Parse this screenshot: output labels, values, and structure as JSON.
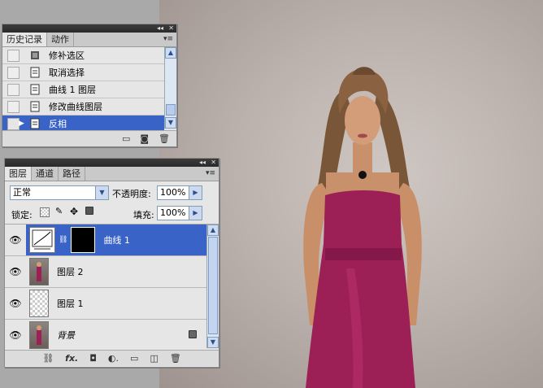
{
  "history_panel": {
    "tabs": [
      "历史记录",
      "动作"
    ],
    "items": [
      {
        "label": "修补选区",
        "icon": "patch-icon",
        "selected": false
      },
      {
        "label": "取消选择",
        "icon": "document-icon",
        "selected": false
      },
      {
        "label": "曲线 1 图层",
        "icon": "document-icon",
        "selected": false
      },
      {
        "label": "修改曲线图层",
        "icon": "document-icon",
        "selected": false
      },
      {
        "label": "反相",
        "icon": "document-icon",
        "selected": true
      }
    ]
  },
  "layers_panel": {
    "tabs": [
      "图层",
      "通道",
      "路径"
    ],
    "blend_mode": "正常",
    "opacity_label": "不透明度:",
    "opacity_value": "100%",
    "lock_label": "锁定:",
    "fill_label": "填充:",
    "fill_value": "100%",
    "layers": [
      {
        "label": "曲线 1",
        "selected": true
      },
      {
        "label": "图层 2",
        "selected": false
      },
      {
        "label": "图层 1",
        "selected": false
      },
      {
        "label": "背景",
        "selected": false,
        "locked": true
      }
    ]
  },
  "colors": {
    "selection": "#3a63c8",
    "dress": "#9c1f55"
  }
}
